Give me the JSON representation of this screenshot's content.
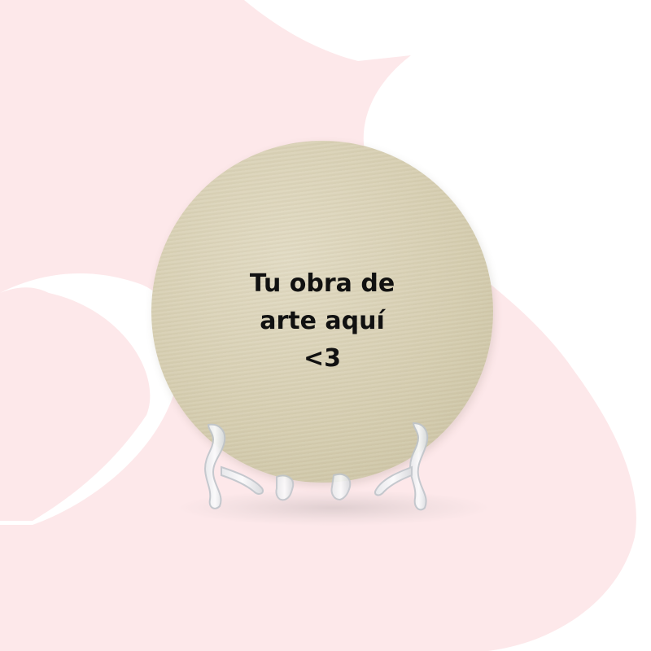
{
  "product": {
    "text_lines": [
      "Tu obra de",
      "arte aquí",
      "<3"
    ],
    "disc_color": "#d6ceb1",
    "background_accent_color": "#fde8ea",
    "stand_material": "clear-acrylic"
  }
}
